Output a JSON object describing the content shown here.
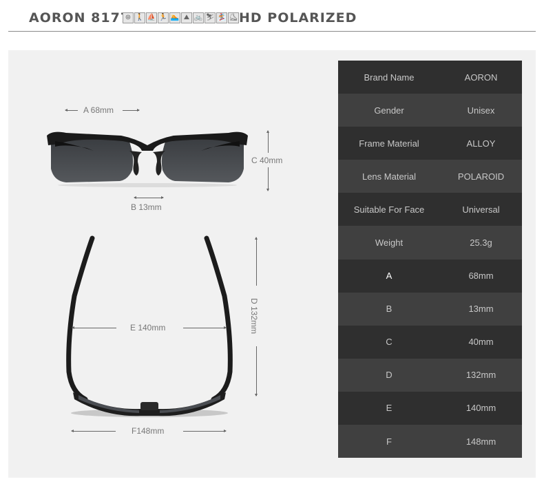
{
  "header": {
    "model": "AORON 8177",
    "tagline": "HD POLARIZED",
    "sport_icons": [
      {
        "name": "driving",
        "glyph": "⊛"
      },
      {
        "name": "walking",
        "glyph": "🚶"
      },
      {
        "name": "fishing",
        "glyph": "⛵"
      },
      {
        "name": "running",
        "glyph": "🏃"
      },
      {
        "name": "swimming",
        "glyph": "🏊"
      },
      {
        "name": "climbing",
        "glyph": "⛰"
      },
      {
        "name": "cycling",
        "glyph": "🚲"
      },
      {
        "name": "skiing",
        "glyph": "⛷"
      },
      {
        "name": "snowboarding",
        "glyph": "🏂"
      },
      {
        "name": "skating",
        "glyph": "⛸"
      }
    ]
  },
  "dimensions": {
    "a": "A 68mm",
    "b": "B 13mm",
    "c": "C 40mm",
    "d": "D 132mm",
    "e": "E 140mm",
    "f": "F148mm"
  },
  "colors": {
    "row_dark": "#2f2f2f",
    "row_light": "#404040",
    "panel_bg": "#f1f1f1",
    "title": "#555555"
  },
  "specs": [
    {
      "key": "Brand Name",
      "value": "AORON"
    },
    {
      "key": "Gender",
      "value": "Unisex"
    },
    {
      "key": "Frame Material",
      "value": "ALLOY"
    },
    {
      "key": "Lens Material",
      "value": "POLAROID"
    },
    {
      "key": "Suitable For Face",
      "value": "Universal"
    },
    {
      "key": "Weight",
      "value": "25.3g"
    },
    {
      "key": "A",
      "value": "68mm"
    },
    {
      "key": "B",
      "value": "13mm"
    },
    {
      "key": "C",
      "value": "40mm"
    },
    {
      "key": "D",
      "value": "132mm"
    },
    {
      "key": "E",
      "value": "140mm"
    },
    {
      "key": "F",
      "value": "148mm"
    }
  ]
}
